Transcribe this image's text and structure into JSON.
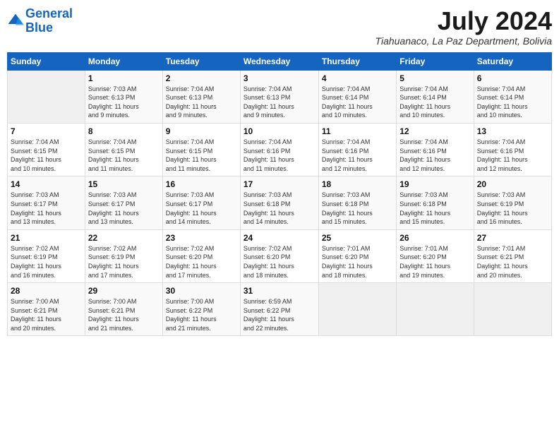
{
  "logo": {
    "line1": "General",
    "line2": "Blue"
  },
  "title": "July 2024",
  "location": "Tiahuanaco, La Paz Department, Bolivia",
  "days_of_week": [
    "Sunday",
    "Monday",
    "Tuesday",
    "Wednesday",
    "Thursday",
    "Friday",
    "Saturday"
  ],
  "weeks": [
    [
      {
        "day": "",
        "info": ""
      },
      {
        "day": "1",
        "info": "Sunrise: 7:03 AM\nSunset: 6:13 PM\nDaylight: 11 hours\nand 9 minutes."
      },
      {
        "day": "2",
        "info": "Sunrise: 7:04 AM\nSunset: 6:13 PM\nDaylight: 11 hours\nand 9 minutes."
      },
      {
        "day": "3",
        "info": "Sunrise: 7:04 AM\nSunset: 6:13 PM\nDaylight: 11 hours\nand 9 minutes."
      },
      {
        "day": "4",
        "info": "Sunrise: 7:04 AM\nSunset: 6:14 PM\nDaylight: 11 hours\nand 10 minutes."
      },
      {
        "day": "5",
        "info": "Sunrise: 7:04 AM\nSunset: 6:14 PM\nDaylight: 11 hours\nand 10 minutes."
      },
      {
        "day": "6",
        "info": "Sunrise: 7:04 AM\nSunset: 6:14 PM\nDaylight: 11 hours\nand 10 minutes."
      }
    ],
    [
      {
        "day": "7",
        "info": "Sunrise: 7:04 AM\nSunset: 6:15 PM\nDaylight: 11 hours\nand 10 minutes."
      },
      {
        "day": "8",
        "info": "Sunrise: 7:04 AM\nSunset: 6:15 PM\nDaylight: 11 hours\nand 11 minutes."
      },
      {
        "day": "9",
        "info": "Sunrise: 7:04 AM\nSunset: 6:15 PM\nDaylight: 11 hours\nand 11 minutes."
      },
      {
        "day": "10",
        "info": "Sunrise: 7:04 AM\nSunset: 6:16 PM\nDaylight: 11 hours\nand 11 minutes."
      },
      {
        "day": "11",
        "info": "Sunrise: 7:04 AM\nSunset: 6:16 PM\nDaylight: 11 hours\nand 12 minutes."
      },
      {
        "day": "12",
        "info": "Sunrise: 7:04 AM\nSunset: 6:16 PM\nDaylight: 11 hours\nand 12 minutes."
      },
      {
        "day": "13",
        "info": "Sunrise: 7:04 AM\nSunset: 6:16 PM\nDaylight: 11 hours\nand 12 minutes."
      }
    ],
    [
      {
        "day": "14",
        "info": "Sunrise: 7:03 AM\nSunset: 6:17 PM\nDaylight: 11 hours\nand 13 minutes."
      },
      {
        "day": "15",
        "info": "Sunrise: 7:03 AM\nSunset: 6:17 PM\nDaylight: 11 hours\nand 13 minutes."
      },
      {
        "day": "16",
        "info": "Sunrise: 7:03 AM\nSunset: 6:17 PM\nDaylight: 11 hours\nand 14 minutes."
      },
      {
        "day": "17",
        "info": "Sunrise: 7:03 AM\nSunset: 6:18 PM\nDaylight: 11 hours\nand 14 minutes."
      },
      {
        "day": "18",
        "info": "Sunrise: 7:03 AM\nSunset: 6:18 PM\nDaylight: 11 hours\nand 15 minutes."
      },
      {
        "day": "19",
        "info": "Sunrise: 7:03 AM\nSunset: 6:18 PM\nDaylight: 11 hours\nand 15 minutes."
      },
      {
        "day": "20",
        "info": "Sunrise: 7:03 AM\nSunset: 6:19 PM\nDaylight: 11 hours\nand 16 minutes."
      }
    ],
    [
      {
        "day": "21",
        "info": "Sunrise: 7:02 AM\nSunset: 6:19 PM\nDaylight: 11 hours\nand 16 minutes."
      },
      {
        "day": "22",
        "info": "Sunrise: 7:02 AM\nSunset: 6:19 PM\nDaylight: 11 hours\nand 17 minutes."
      },
      {
        "day": "23",
        "info": "Sunrise: 7:02 AM\nSunset: 6:20 PM\nDaylight: 11 hours\nand 17 minutes."
      },
      {
        "day": "24",
        "info": "Sunrise: 7:02 AM\nSunset: 6:20 PM\nDaylight: 11 hours\nand 18 minutes."
      },
      {
        "day": "25",
        "info": "Sunrise: 7:01 AM\nSunset: 6:20 PM\nDaylight: 11 hours\nand 18 minutes."
      },
      {
        "day": "26",
        "info": "Sunrise: 7:01 AM\nSunset: 6:20 PM\nDaylight: 11 hours\nand 19 minutes."
      },
      {
        "day": "27",
        "info": "Sunrise: 7:01 AM\nSunset: 6:21 PM\nDaylight: 11 hours\nand 20 minutes."
      }
    ],
    [
      {
        "day": "28",
        "info": "Sunrise: 7:00 AM\nSunset: 6:21 PM\nDaylight: 11 hours\nand 20 minutes."
      },
      {
        "day": "29",
        "info": "Sunrise: 7:00 AM\nSunset: 6:21 PM\nDaylight: 11 hours\nand 21 minutes."
      },
      {
        "day": "30",
        "info": "Sunrise: 7:00 AM\nSunset: 6:22 PM\nDaylight: 11 hours\nand 21 minutes."
      },
      {
        "day": "31",
        "info": "Sunrise: 6:59 AM\nSunset: 6:22 PM\nDaylight: 11 hours\nand 22 minutes."
      },
      {
        "day": "",
        "info": ""
      },
      {
        "day": "",
        "info": ""
      },
      {
        "day": "",
        "info": ""
      }
    ]
  ]
}
